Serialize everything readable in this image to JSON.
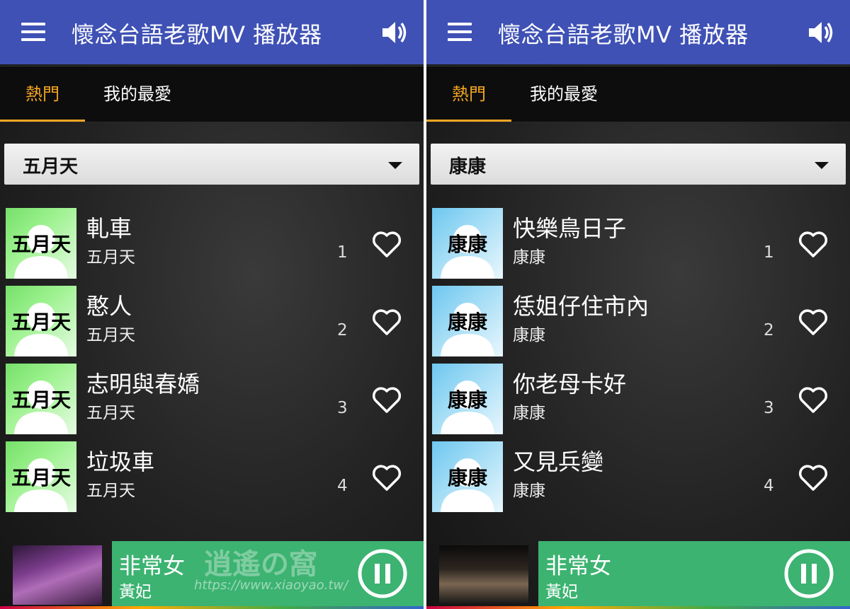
{
  "colors": {
    "appbar": "#3f51b5",
    "accent": "#f5a623",
    "player": "#3cb371"
  },
  "screens": [
    {
      "app_title": "懷念台語老歌MV 播放器",
      "tabs": {
        "hot": "熱門",
        "favorites": "我的最愛"
      },
      "dropdown": {
        "selected": "五月天"
      },
      "thumb_label": "五月天",
      "songs": [
        {
          "title": "軋車",
          "artist": "五月天",
          "rank": "1"
        },
        {
          "title": "憨人",
          "artist": "五月天",
          "rank": "2"
        },
        {
          "title": "志明與春嬌",
          "artist": "五月天",
          "rank": "3"
        },
        {
          "title": "垃圾車",
          "artist": "五月天",
          "rank": "4"
        }
      ],
      "player": {
        "title": "非常女",
        "artist": "黃妃",
        "watermark": "逍遙の窩",
        "watermark_url": "https://www.xiaoyao.tw/"
      }
    },
    {
      "app_title": "懷念台語老歌MV 播放器",
      "tabs": {
        "hot": "熱門",
        "favorites": "我的最愛"
      },
      "dropdown": {
        "selected": "康康"
      },
      "thumb_label": "康康",
      "songs": [
        {
          "title": "快樂鳥日子",
          "artist": "康康",
          "rank": "1"
        },
        {
          "title": "恁姐仔住市內",
          "artist": "康康",
          "rank": "2"
        },
        {
          "title": "你老母卡好",
          "artist": "康康",
          "rank": "3"
        },
        {
          "title": "又見兵變",
          "artist": "康康",
          "rank": "4"
        }
      ],
      "player": {
        "title": "非常女",
        "artist": "黃妃"
      }
    }
  ],
  "icons": [
    "menu-icon",
    "volume-icon",
    "dropdown-caret-icon",
    "heart-icon",
    "pause-icon",
    "avatar-placeholder-icon"
  ]
}
